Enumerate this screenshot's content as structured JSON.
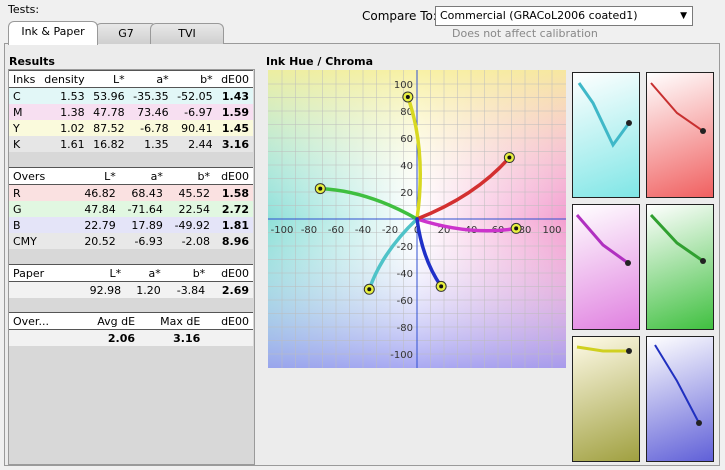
{
  "header": {
    "tests_label": "Tests:",
    "compare_label": "Compare To:",
    "compare_value": "Commercial (GRACoL2006 coated1)",
    "compare_note": "Does not affect calibration"
  },
  "tabs": [
    {
      "label": "Ink & Paper",
      "active": true
    },
    {
      "label": "G7",
      "active": false
    },
    {
      "label": "TVI",
      "active": false
    }
  ],
  "results": {
    "title": "Results",
    "inks": {
      "header": [
        "Inks",
        "density",
        "L*",
        "a*",
        "b*",
        "dE00"
      ],
      "rows": [
        {
          "name": "C",
          "density": "1.53",
          "L": "53.96",
          "a": "-35.35",
          "b": "-52.05",
          "dE": "1.43",
          "color": "#e2f7f7"
        },
        {
          "name": "M",
          "density": "1.38",
          "L": "47.78",
          "a": "73.46",
          "b": "-6.97",
          "dE": "1.59",
          "color": "#f7dff1"
        },
        {
          "name": "Y",
          "density": "1.02",
          "L": "87.52",
          "a": "-6.78",
          "b": "90.41",
          "dE": "1.45",
          "color": "#fafadc"
        },
        {
          "name": "K",
          "density": "1.61",
          "L": "16.82",
          "a": "1.35",
          "b": "2.44",
          "dE": "3.16",
          "color": "#e6e6e6"
        }
      ]
    },
    "overs": {
      "header": [
        "Overs",
        "L*",
        "a*",
        "b*",
        "dE00"
      ],
      "rows": [
        {
          "name": "R",
          "L": "46.82",
          "a": "68.43",
          "b": "45.52",
          "dE": "1.58",
          "color": "#fae1e1"
        },
        {
          "name": "G",
          "L": "47.84",
          "a": "-71.64",
          "b": "22.54",
          "dE": "2.72",
          "color": "#e1f7e1"
        },
        {
          "name": "B",
          "L": "22.79",
          "a": "17.89",
          "b": "-49.92",
          "dE": "1.81",
          "color": "#e4e4f8"
        },
        {
          "name": "CMY",
          "L": "20.52",
          "a": "-6.93",
          "b": "-2.08",
          "dE": "8.96",
          "color": "#e8e8e8"
        }
      ]
    },
    "paper": {
      "header": [
        "Paper",
        "L*",
        "a*",
        "b*",
        "dE00"
      ],
      "row": {
        "L": "92.98",
        "a": "1.20",
        "b": "-3.84",
        "dE": "2.69"
      }
    },
    "overall": {
      "header": [
        "Over...",
        "Avg dE",
        "Max dE",
        "dE00"
      ],
      "row": {
        "avg": "2.06",
        "max": "3.16"
      }
    }
  },
  "plot": {
    "title": "Ink Hue / Chroma",
    "x_ticks": [
      "-100",
      "-80",
      "-60",
      "-40",
      "-20",
      "0",
      "20",
      "40",
      "60",
      "80",
      "100"
    ],
    "y_ticks": [
      "100",
      "80",
      "60",
      "40",
      "20",
      "0",
      "-20",
      "-40",
      "-60",
      "-80",
      "-100"
    ],
    "colors": {
      "C": "#4fc3c8",
      "M": "#cc33cc",
      "Y": "#d8d820",
      "R": "#d33030",
      "G": "#3fbf3f",
      "B": "#2030c8"
    }
  },
  "chart_data": {
    "type": "line",
    "title": "Ink Hue / Chroma",
    "xlim": [
      -100,
      100
    ],
    "ylim": [
      -100,
      100
    ],
    "grid": true,
    "series": [
      {
        "name": "C",
        "a": -35.35,
        "b": -52.05
      },
      {
        "name": "M",
        "a": 73.46,
        "b": -6.97
      },
      {
        "name": "Y",
        "a": -6.78,
        "b": 90.41
      },
      {
        "name": "R",
        "a": 68.43,
        "b": 45.52
      },
      {
        "name": "G",
        "a": -71.64,
        "b": 22.54
      },
      {
        "name": "B",
        "a": 17.89,
        "b": -49.92
      }
    ]
  }
}
